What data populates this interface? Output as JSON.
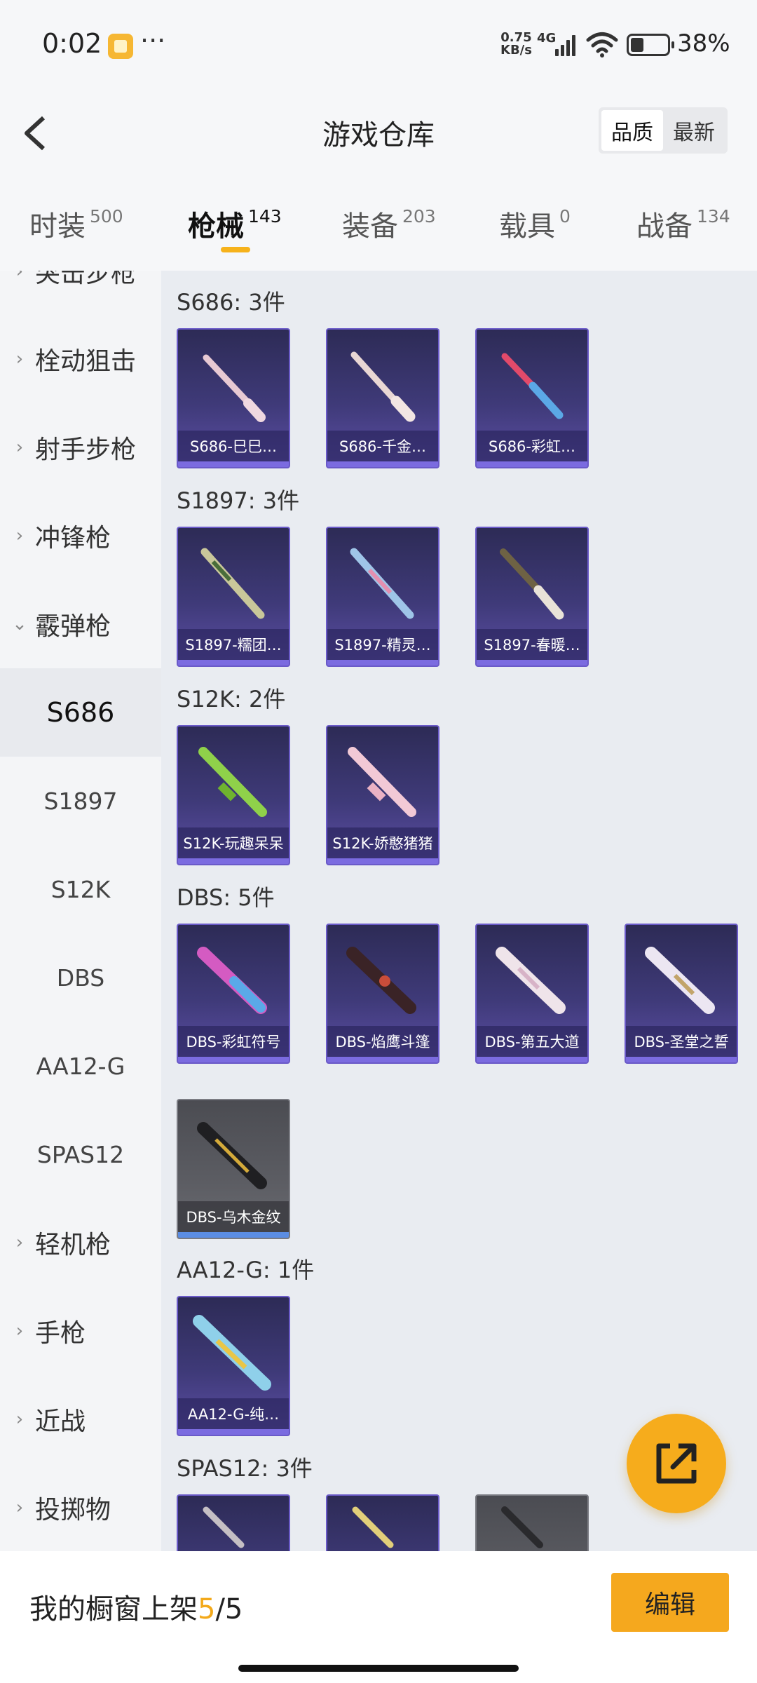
{
  "status_bar": {
    "time": "0:02",
    "dots": "···",
    "net_speed_value": "0.75",
    "net_speed_unit": "KB/s",
    "network": "4G",
    "battery": "38%"
  },
  "header": {
    "title": "游戏仓库",
    "sort_options": [
      "品质",
      "最新"
    ],
    "sort_selected": "品质"
  },
  "tabs": [
    {
      "label": "时装",
      "count": "500"
    },
    {
      "label": "枪械",
      "count": "143",
      "active": true
    },
    {
      "label": "装备",
      "count": "203"
    },
    {
      "label": "载具",
      "count": "0"
    },
    {
      "label": "战备",
      "count": "134"
    }
  ],
  "sidebar": {
    "partial_top": "突击步枪",
    "categories": [
      "栓动狙击",
      "射手步枪",
      "冲锋枪",
      "霰弹枪"
    ],
    "subcategories": [
      "S686",
      "S1897",
      "S12K",
      "DBS",
      "AA12-G",
      "SPAS12"
    ],
    "active_sub": "S686",
    "categories_after": [
      "轻机枪",
      "手枪",
      "近战",
      "投掷物"
    ]
  },
  "groups": [
    {
      "title": "S686: 3件",
      "items": [
        "S686-巳巳…",
        "S686-千金…",
        "S686-彩虹…"
      ]
    },
    {
      "title": "S1897: 3件",
      "items": [
        "S1897-糯团…",
        "S1897-精灵…",
        "S1897-春暖…"
      ]
    },
    {
      "title": "S12K: 2件",
      "items": [
        "S12K-玩趣呆呆",
        "S12K-娇憨猪猪"
      ]
    },
    {
      "title": "DBS: 5件",
      "items": [
        "DBS-彩虹符号",
        "DBS-焰鹰斗篷",
        "DBS-第五大道",
        "DBS-圣堂之誓",
        "DBS-乌木金纹"
      ]
    },
    {
      "title": "AA12-G: 1件",
      "items": [
        "AA12-G-纯…"
      ]
    },
    {
      "title": "SPAS12: 3件",
      "items": [
        "",
        "",
        ""
      ]
    }
  ],
  "bottom_bar": {
    "label": "我的橱窗上架",
    "current": "5",
    "total": "/5",
    "edit_label": "编辑"
  },
  "colors": {
    "accent": "#f5a81e",
    "card_purple": "#3f3a79",
    "card_gray": "#5c5d63"
  }
}
